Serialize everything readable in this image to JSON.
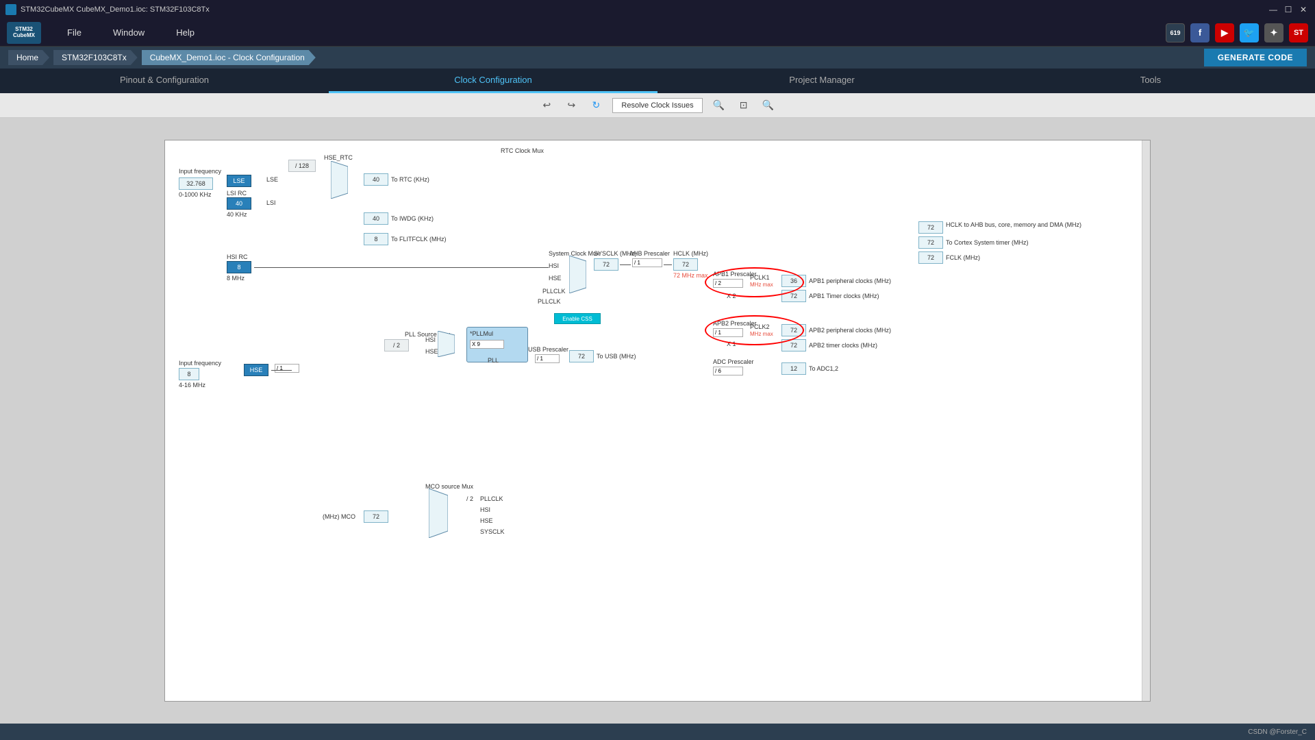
{
  "titlebar": {
    "title": "STM32CubeMX CubeMX_Demo1.ioc: STM32F103C8Tx",
    "minimize": "—",
    "maximize": "☐",
    "close": "✕"
  },
  "menubar": {
    "file": "File",
    "window": "Window",
    "help": "Help"
  },
  "breadcrumb": {
    "home": "Home",
    "chip": "STM32F103C8Tx",
    "active": "CubeMX_Demo1.ioc - Clock Configuration",
    "generate": "GENERATE CODE"
  },
  "tabs": [
    {
      "label": "Pinout & Configuration",
      "active": false
    },
    {
      "label": "Clock Configuration",
      "active": true
    },
    {
      "label": "Project Manager",
      "active": false
    },
    {
      "label": "Tools",
      "active": false
    }
  ],
  "toolbar": {
    "resolve_btn": "Resolve Clock Issues",
    "zoom_in": "+",
    "zoom_out": "−",
    "fit": "⊞",
    "refresh": "↻",
    "undo": "↩",
    "redo": "↪"
  },
  "diagram": {
    "rtc_clock_mux": "RTC Clock Mux",
    "system_clock_mux": "System Clock Mux",
    "pll_source_mux": "PLL Source Mux",
    "mco_source_mux": "MCO source Mux",
    "usb_prescaler": "USB Prescaler",
    "input_freq_top_label": "Input frequency",
    "input_freq_top_value": "32.768",
    "input_freq_top_range": "0-1000 KHz",
    "input_freq_bot_label": "Input frequency",
    "input_freq_bot_value": "8",
    "input_freq_bot_range": "4-16 MHz",
    "lse_label": "LSE",
    "lsi_rc_label": "LSI RC",
    "lsi_rc_value": "40",
    "lsi_rc_freq": "40 KHz",
    "hsi_rc_label": "HSI RC",
    "hsi_rc_value": "8",
    "hsi_rc_freq": "8 MHz",
    "hse_label": "HSE",
    "hse_value": "8",
    "div128": "/ 128",
    "hse_rtc": "HSE_RTC",
    "lse_wire": "LSE",
    "lsi_wire": "LSI",
    "hsi_wire": "HSI",
    "hse_wire": "HSE",
    "rtc_out_40": "40",
    "rtc_label": "To RTC (KHz)",
    "iwdg_out_40": "40",
    "iwdg_label": "To IWDG (KHz)",
    "flit_out_8": "8",
    "flit_label": "To FLITFCLK (MHz)",
    "sysclk_label": "SYSCLK (MHz)",
    "sysclk_value": "72",
    "ahb_prescaler": "AHB Prescaler",
    "ahb_div": "/ 1",
    "hclk_label": "HCLK (MHz)",
    "hclk_value": "72",
    "hclk_max": "72 MHz max",
    "apb1_prescaler": "APB1 Prescaler",
    "apb1_div": "/ 2",
    "pclk1": "PCLK1",
    "pclk1_mhz_max": "MHz max",
    "apb1_periph_value": "36",
    "apb1_periph_label": "APB1 peripheral clocks (MHz)",
    "x2_label": "X 2",
    "apb1_timer_value": "72",
    "apb1_timer_label": "APB1 Timer clocks (MHz)",
    "apb2_prescaler": "APB2 Prescaler",
    "apb2_div": "/ 1",
    "pclk2": "PCLK2",
    "pclk2_mhz_max": "MHz max",
    "apb2_periph_value": "72",
    "apb2_periph_label": "APB2 peripheral clocks (MHz)",
    "x1_label": "X 1",
    "apb2_timer_value": "72",
    "apb2_timer_label": "APB2 timer clocks (MHz)",
    "adc_prescaler": "ADC Prescaler",
    "adc_div": "/ 6",
    "adc_value": "12",
    "adc_label": "To ADC1,2",
    "hclk_ahb_value": "72",
    "hclk_ahb_label": "HCLK to AHB bus, core, memory and DMA (MHz)",
    "cortex_value": "72",
    "cortex_label": "To Cortex System timer (MHz)",
    "fclk_value": "72",
    "fclk_label": "FCLK (MHz)",
    "pll_mul_label": "*PLLMul",
    "pll_x9": "X 9",
    "pll_div2": "/ 2",
    "pll_label": "PLL",
    "pllclk": "PLLCLK",
    "enable_css": "Enable CSS",
    "usb_div": "/ 1",
    "usb_out": "72",
    "usb_label": "To USB (MHz)",
    "mco_value": "72",
    "mco_label": "(MHz) MCO",
    "mco_div2": "/ 2",
    "mco_pllclk": "PLLCLK",
    "mco_hsi": "HSI",
    "mco_hse": "HSE",
    "mco_sysclk": "SYSCLK",
    "hse_div1": "/ 1",
    "pll_hsi": "HSI",
    "pll_hse": "HSE"
  },
  "statusbar": {
    "credit": "CSDN @Forster_C"
  }
}
